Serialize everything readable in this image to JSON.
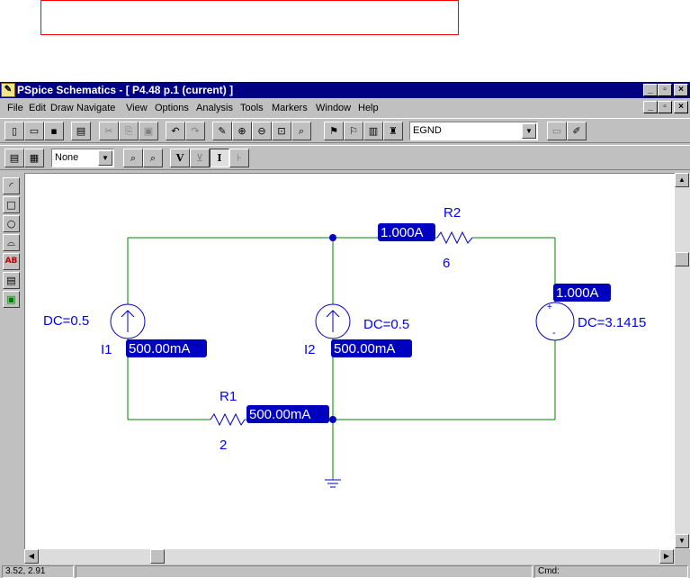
{
  "window": {
    "title": "PSpice Schematics - [ P4.48  p.1 (current)  ]",
    "app_icon": "schematic-app-icon",
    "min_label": "_",
    "max_label": "▫",
    "close_label": "×"
  },
  "menu": {
    "items": [
      "File",
      "Edit",
      "Draw",
      "Navigate",
      "View",
      "Options",
      "Analysis",
      "Tools",
      "Markers",
      "Window",
      "Help"
    ]
  },
  "toolbar": {
    "part_combo_value": "EGND",
    "display_combo_value": "None",
    "buttons": [
      "new-icon",
      "open-icon",
      "save-icon",
      "print-icon",
      "cut-icon",
      "copy-icon",
      "paste-icon",
      "undo-icon",
      "redo-icon",
      "draw-wire-icon",
      "zoom-in-icon",
      "zoom-out-icon",
      "zoom-area-icon",
      "zoom-fit-icon",
      "setup-analysis-icon",
      "simulate-icon",
      "edit-attributes-icon",
      "get-part-icon",
      "symbol-icon",
      "edit-symbol-icon"
    ],
    "marker_labels": {
      "voltage": "V",
      "current": "I"
    }
  },
  "circuit": {
    "wire_color": "#008000",
    "component_color": "#0000c0",
    "label_color": "#0000ff",
    "badge_bg": "#0000c0",
    "badge_fg": "#ffffff",
    "i1_name": "I1",
    "i1_value": "DC=0.5",
    "i1_current": "500.00mA",
    "i2_name": "I2",
    "i2_value": "DC=0.5",
    "i2_current": "500.00mA",
    "r1_name": "R1",
    "r1_value": "2",
    "r1_current": "500.00mA",
    "r2_name": "R2",
    "r2_value": "6",
    "r2_current": "1.000A",
    "v_value": "DC=3.1415",
    "v_current": "1.000A",
    "plus": "+",
    "minus": "-"
  },
  "status": {
    "coords": "3.52,  2.91",
    "cmd": "Cmd:"
  }
}
